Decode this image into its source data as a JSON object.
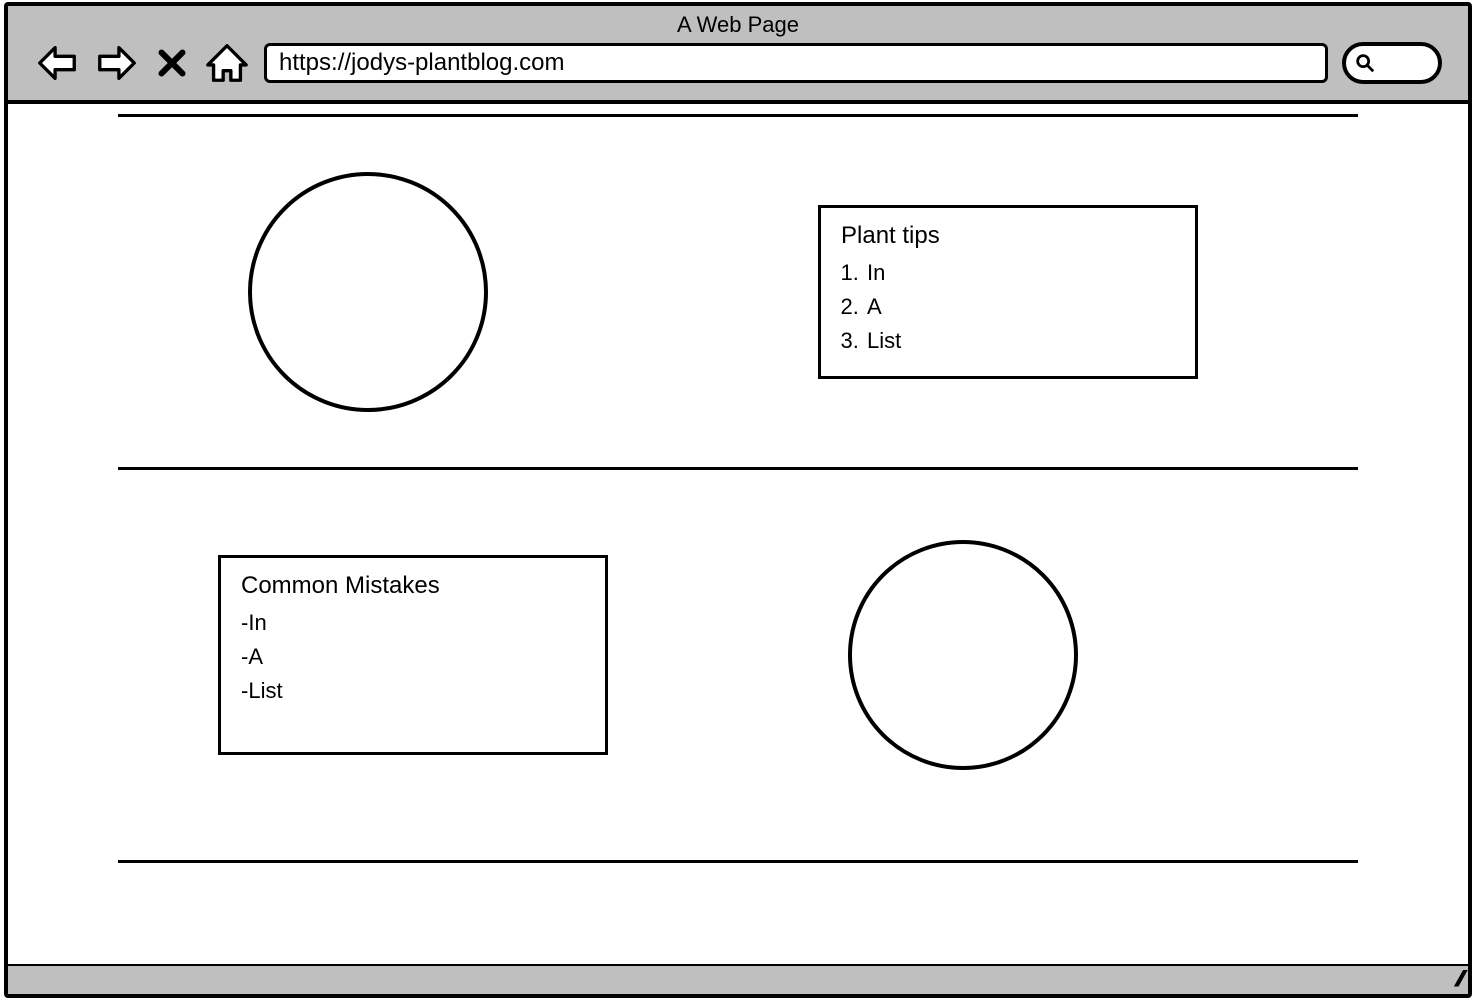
{
  "window": {
    "title": "A Web Page",
    "url": "https://jodys-plantblog.com"
  },
  "sections": {
    "tips": {
      "title": "Plant tips",
      "items": [
        "In",
        "A",
        "List"
      ]
    },
    "mistakes": {
      "title": "Common Mistakes",
      "items": [
        "In",
        "A",
        "List"
      ]
    }
  }
}
